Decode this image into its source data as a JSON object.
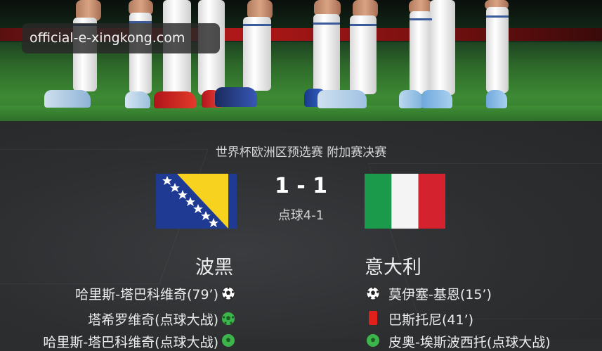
{
  "watermark": "official-e-xingkong.com",
  "competition": "世界杯欧洲区预选赛 附加赛决赛",
  "score": "1 - 1",
  "penalties": "点球4-1",
  "home": {
    "name": "波黑",
    "events": [
      {
        "text": "哈里斯-塔巴科维奇(79’)",
        "icon": "soccer-ball-icon"
      },
      {
        "text": "塔希罗维奇(点球大战)",
        "icon": "penalty-scored-icon"
      },
      {
        "text": "哈里斯-塔巴科维奇(点球大战)",
        "icon": "penalty-scored-icon"
      }
    ]
  },
  "away": {
    "name": "意大利",
    "events": [
      {
        "text": "莫伊塞-基恩(15’)",
        "icon": "soccer-ball-icon"
      },
      {
        "text": "巴斯托尼(41’)",
        "icon": "red-card-icon"
      },
      {
        "text": "皮奥-埃斯波西托(点球大战)",
        "icon": "penalty-missed-icon"
      }
    ]
  },
  "colors": {
    "red_card": "#e0201a",
    "penalty_green": "#3cb54a",
    "bosnia_blue": "#1f3a93",
    "bosnia_yellow": "#f7d21e",
    "italy_green": "#1b9a4b",
    "italy_red": "#d4232f"
  }
}
